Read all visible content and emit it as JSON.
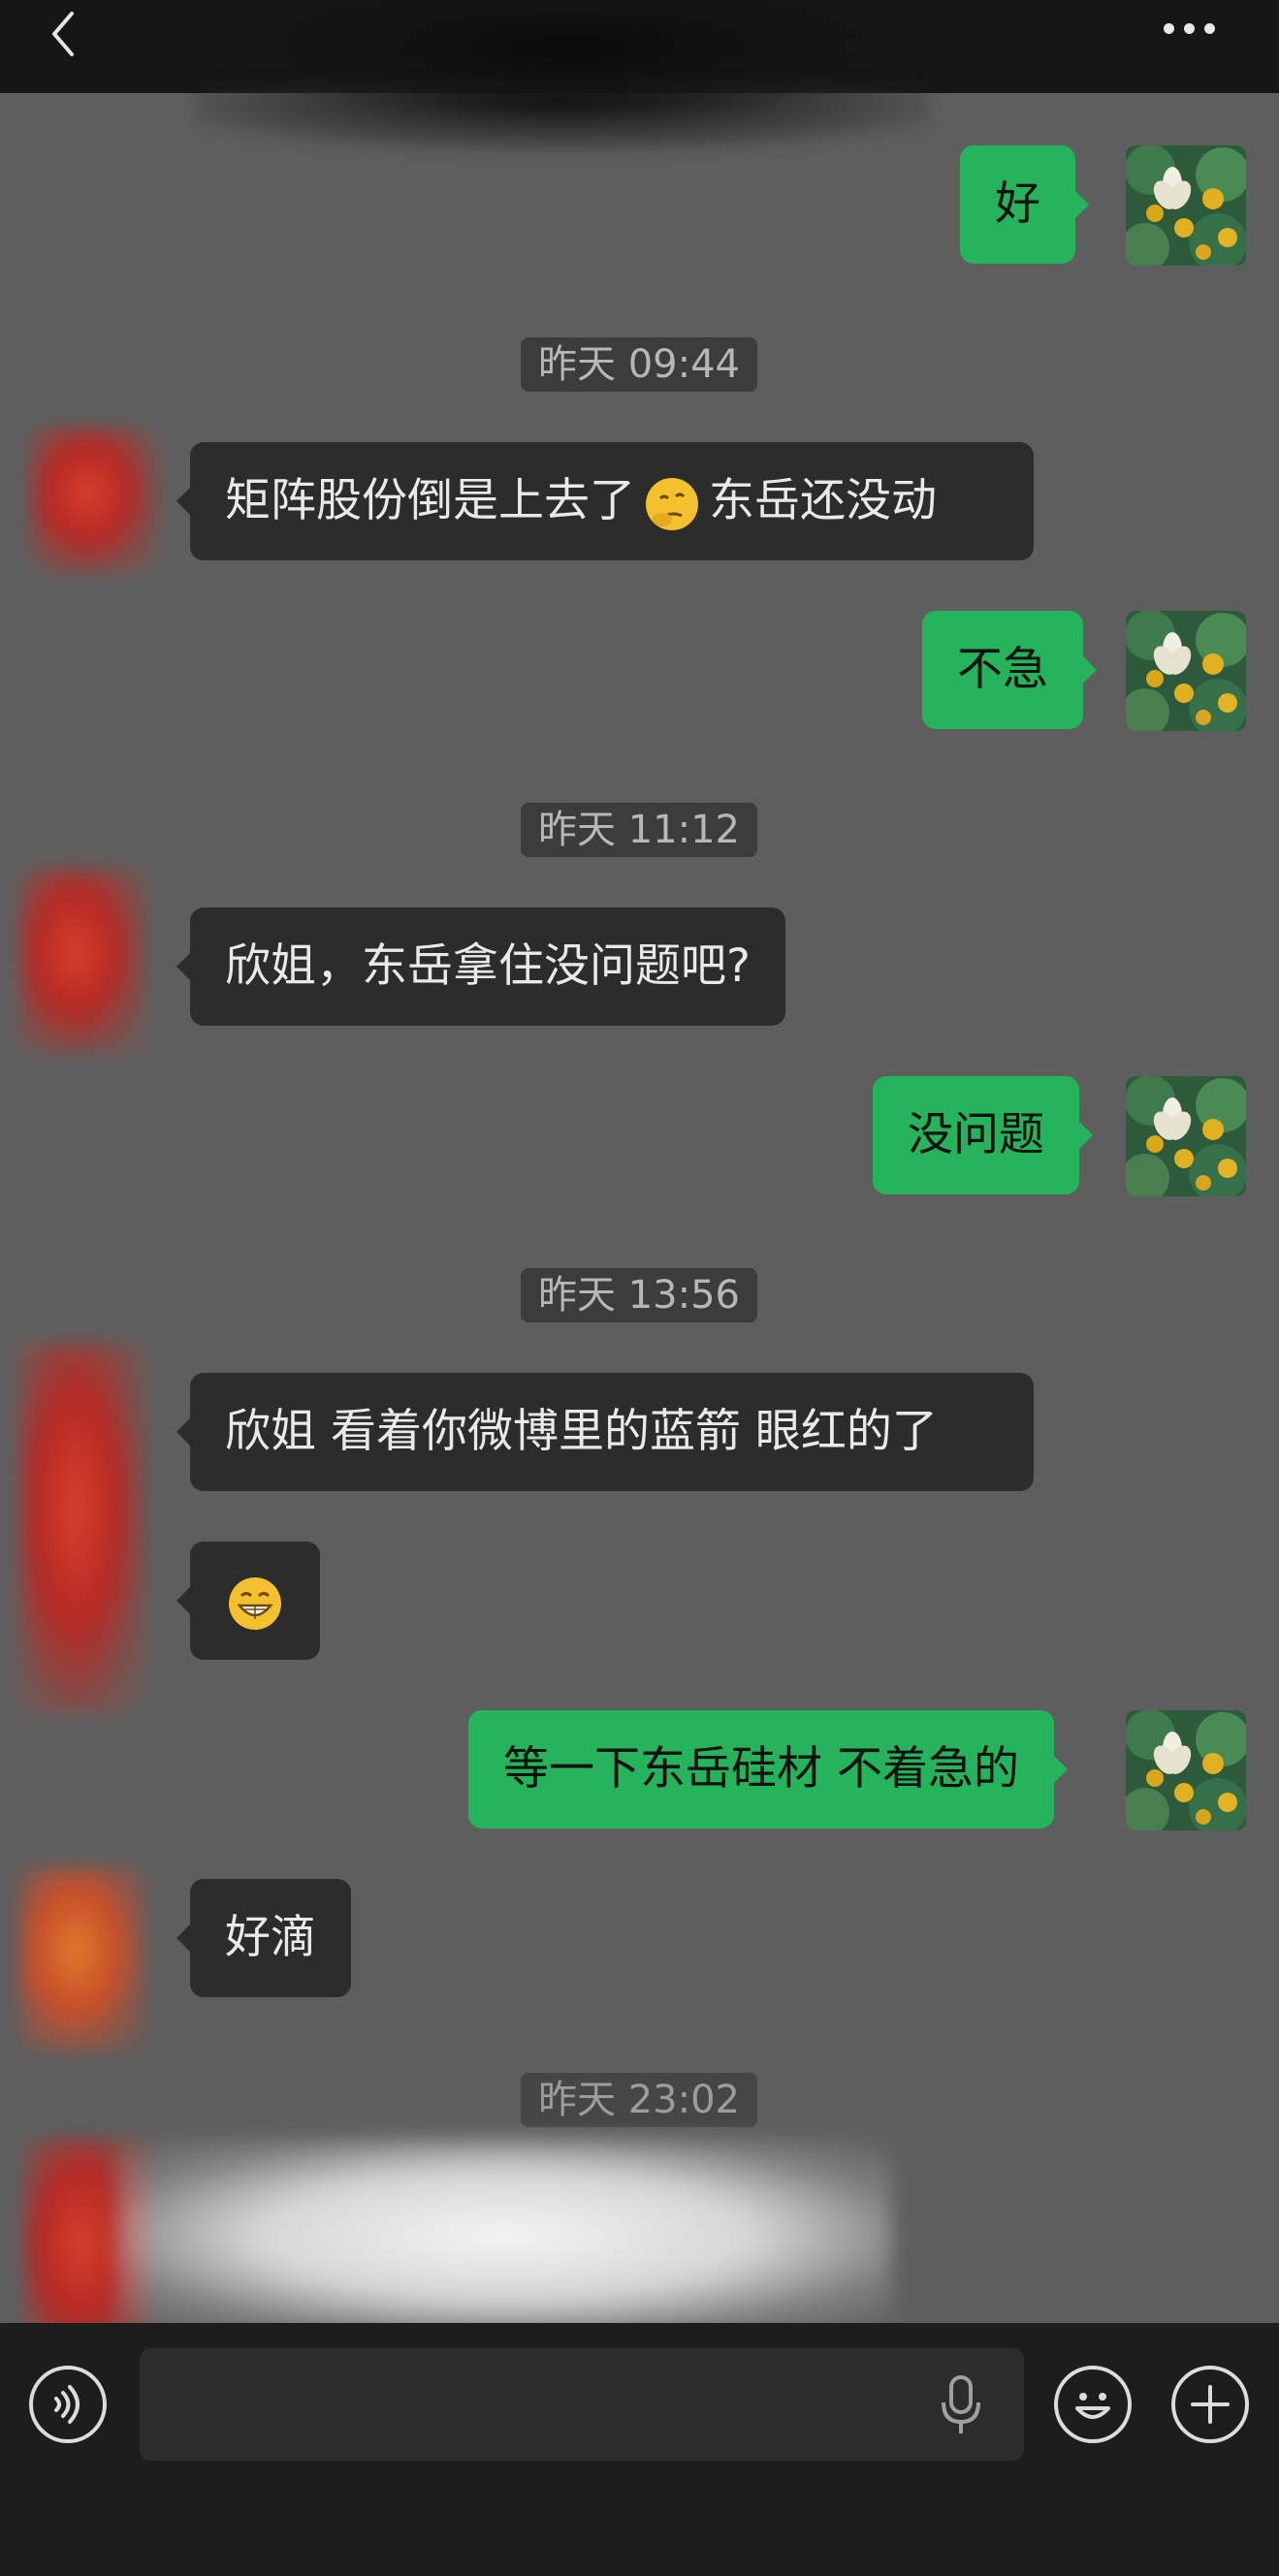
{
  "header": {
    "back_label": "<",
    "more_label": "···"
  },
  "messages": [
    {
      "side": "right",
      "text": "好"
    },
    {
      "type": "timestamp",
      "text": "昨天 09:44"
    },
    {
      "side": "left",
      "text_before": "矩阵股份倒是上去了",
      "emoji": "thinking-face",
      "text_after": "东岳还没动"
    },
    {
      "side": "right",
      "text": "不急"
    },
    {
      "type": "timestamp",
      "text": "昨天 11:12"
    },
    {
      "side": "left",
      "text": "欣姐，东岳拿住没问题吧?"
    },
    {
      "side": "right",
      "text": "没问题"
    },
    {
      "type": "timestamp",
      "text": "昨天 13:56"
    },
    {
      "side": "left",
      "text": "欣姐 看着你微博里的蓝箭  眼红的了"
    },
    {
      "side": "left",
      "emoji": "grinning-face"
    },
    {
      "side": "right",
      "text": "等一下东岳硅材 不着急的"
    },
    {
      "side": "left",
      "text": "好滴"
    },
    {
      "type": "timestamp",
      "text": "昨天 23:02"
    }
  ],
  "input_bar": {
    "voice_icon": "voice-mode-icon",
    "mic_icon": "microphone-icon",
    "emoji_icon": "emoji-icon",
    "plus_icon": "plus-icon",
    "placeholder": ""
  },
  "colors": {
    "background": "#5e5e5e",
    "my_bubble": "#25b45b",
    "their_bubble": "#2c2c2c",
    "header": "#161616"
  }
}
